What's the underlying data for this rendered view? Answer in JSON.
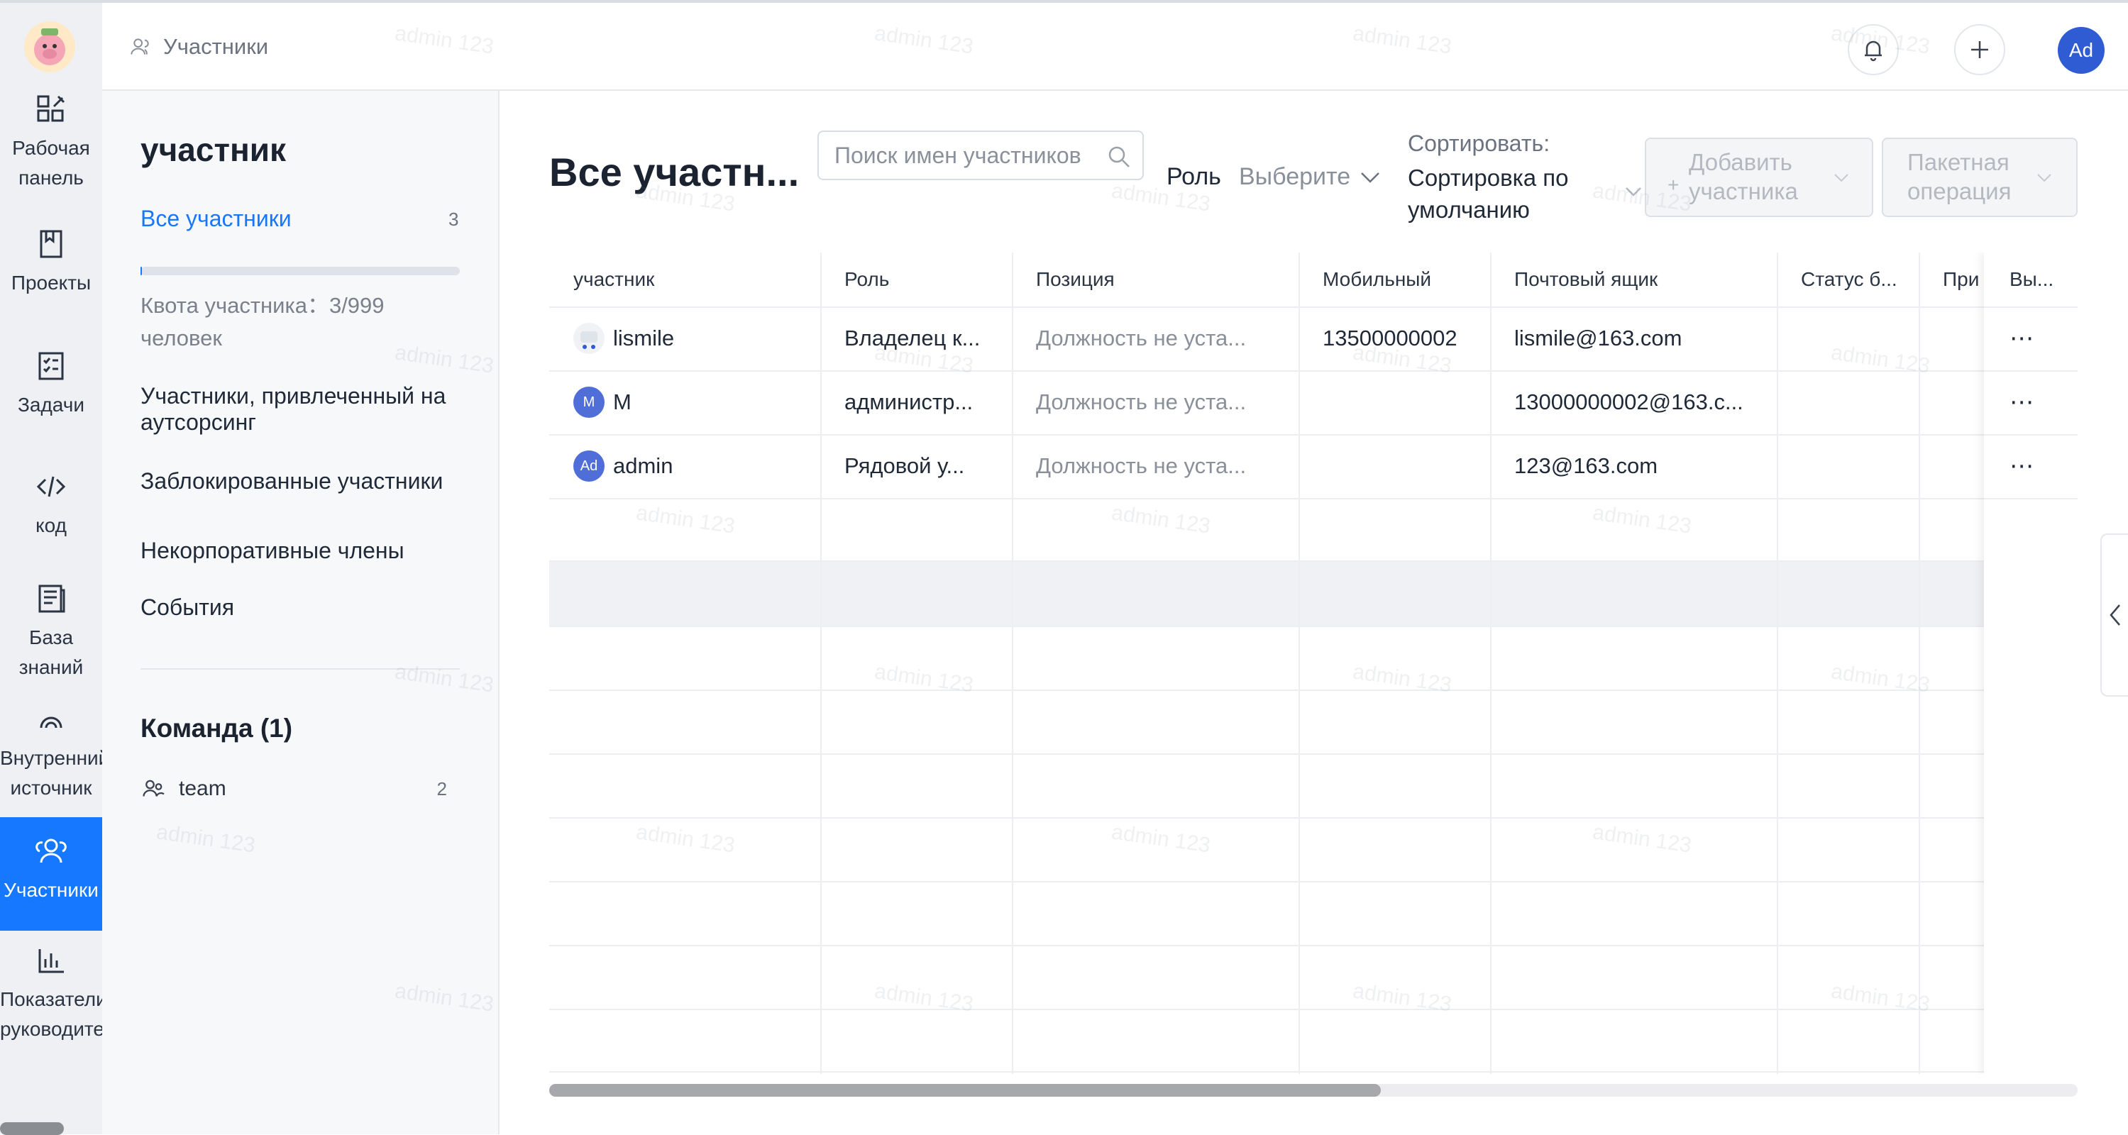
{
  "app": {
    "header": {
      "breadcrumb": "Участники",
      "avatar_text": "Ad"
    },
    "watermark": "admin 123"
  },
  "rail": {
    "items": [
      {
        "label": "Рабочая панель",
        "icon": "dashboard-icon"
      },
      {
        "label": "Проекты",
        "icon": "projects-icon"
      },
      {
        "label": "Задачи",
        "icon": "tasks-icon"
      },
      {
        "label": "код",
        "icon": "code-icon"
      },
      {
        "label": "База знаний",
        "icon": "knowledge-base-icon"
      },
      {
        "label": "Внутренний источник",
        "icon": "inner-source-icon"
      },
      {
        "label": "Участники",
        "icon": "members-icon",
        "active": true
      },
      {
        "label": "Показатели руководителя",
        "icon": "metrics-icon"
      }
    ]
  },
  "panel": {
    "title": "участник",
    "all_members": "Все участники",
    "all_count": "3",
    "quota": "Квота участника：3/999 человек",
    "quota_fraction": 0.003,
    "links": [
      "Участники, привлеченный на аутсорсинг",
      "Заблокированные участники",
      "Некорпоративные члены",
      "События"
    ],
    "team_title": "Команда (1)",
    "team": {
      "name": "team",
      "count": "2"
    }
  },
  "main": {
    "title": "Все участн...",
    "search_placeholder": "Поиск имен участников",
    "role_label": "Роль",
    "role_select": "Выберите",
    "sort_label": "Сортировать:",
    "sort_value": "Сортировка по умолчанию",
    "add_button": "Добавить участника",
    "batch_button": "Пакетная операция"
  },
  "table": {
    "columns": [
      "участник",
      "Роль",
      "Позиция",
      "Мобильный",
      "Почтовый ящик",
      "Статус б...",
      "При",
      "Вы..."
    ],
    "rows": [
      {
        "avatar": "",
        "name": "lismile",
        "role": "Владелец к...",
        "position": "Должность не уста...",
        "mobile": "13500000002",
        "email": "lismile@163.com"
      },
      {
        "avatar": "M",
        "name": "M",
        "role": "администр...",
        "position": "Должность не уста...",
        "mobile": "",
        "email": "13000000002@163.c..."
      },
      {
        "avatar": "Ad",
        "name": "admin",
        "role": "Рядовой у...",
        "position": "Должность не уста...",
        "mobile": "",
        "email": "123@163.com"
      }
    ],
    "more_label": "⋯"
  },
  "colors": {
    "accent": "#1677ff",
    "avatar": "#4f6ed8"
  }
}
